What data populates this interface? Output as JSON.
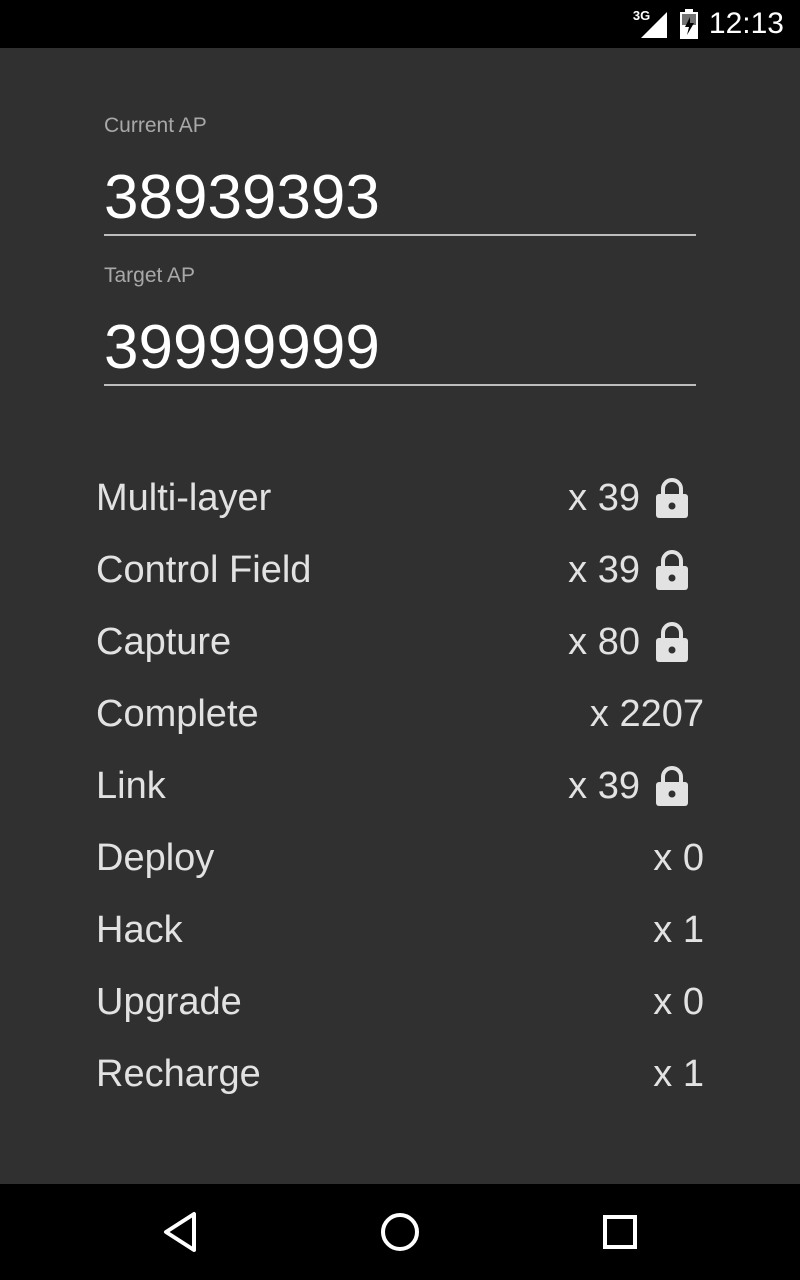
{
  "status_bar": {
    "network": "3G",
    "time": "12:13"
  },
  "current_ap": {
    "label": "Current AP",
    "value": "38939393"
  },
  "target_ap": {
    "label": "Target AP",
    "value": "39999999"
  },
  "actions": [
    {
      "name": "Multi-layer",
      "count": "x 39",
      "locked": true
    },
    {
      "name": "Control Field",
      "count": "x 39",
      "locked": true
    },
    {
      "name": "Capture",
      "count": "x 80",
      "locked": true
    },
    {
      "name": "Complete",
      "count": "x 2207",
      "locked": false
    },
    {
      "name": "Link",
      "count": "x 39",
      "locked": true
    },
    {
      "name": "Deploy",
      "count": "x 0",
      "locked": false
    },
    {
      "name": "Hack",
      "count": "x 1",
      "locked": false
    },
    {
      "name": "Upgrade",
      "count": "x 0",
      "locked": false
    },
    {
      "name": "Recharge",
      "count": "x 1",
      "locked": false
    }
  ],
  "icons": {
    "lock": "lock-icon",
    "back": "back-icon",
    "home": "home-icon",
    "recents": "recents-icon",
    "signal": "signal-icon",
    "battery": "battery-icon"
  },
  "colors": {
    "background": "#303030",
    "text": "#e2e2e2",
    "label": "#a8a8a8",
    "bar": "#000000"
  }
}
